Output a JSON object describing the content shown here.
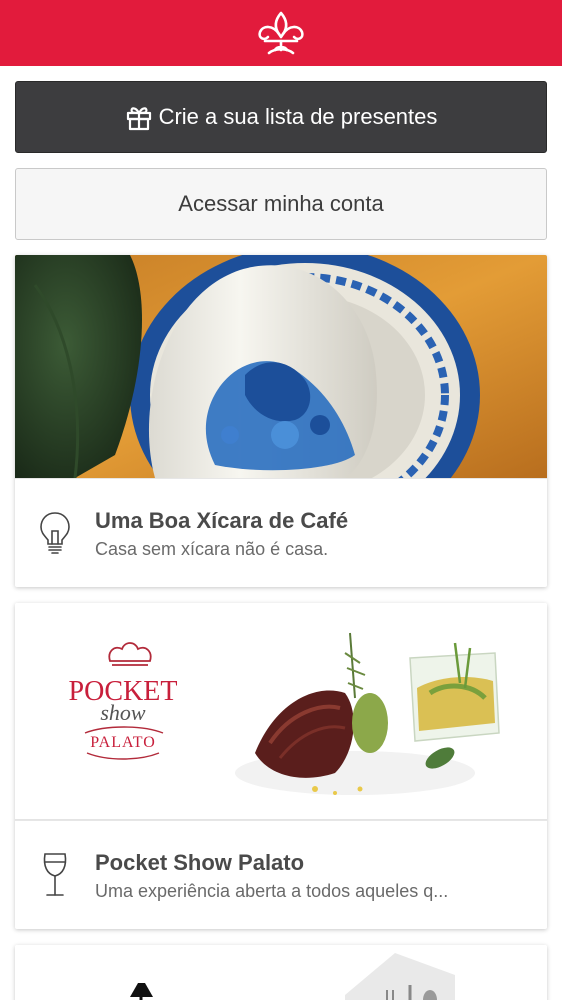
{
  "header": {
    "logo_icon": "fleur-de-lis-icon",
    "background_color": "#e21b3c"
  },
  "actions": {
    "create_list_label": "Crie a sua lista de presentes",
    "create_list_icon": "gift-icon",
    "access_account_label": "Acessar minha conta"
  },
  "cards": [
    {
      "title": "Uma Boa Xícara de Café",
      "subtitle": "Casa sem xícara não é casa.",
      "icon": "lightbulb-icon",
      "image": "blue-white-porcelain-cup-photo"
    },
    {
      "title": "Pocket Show Palato",
      "subtitle": "Uma experiência aberta a todos aqueles q...",
      "icon": "wine-glass-icon",
      "image": "gourmet-dish-photo",
      "logo": {
        "line1": "POCKET",
        "line2": "show",
        "line3": "PALATO"
      }
    },
    {
      "image": "lamp-and-cutlery-photo"
    }
  ]
}
